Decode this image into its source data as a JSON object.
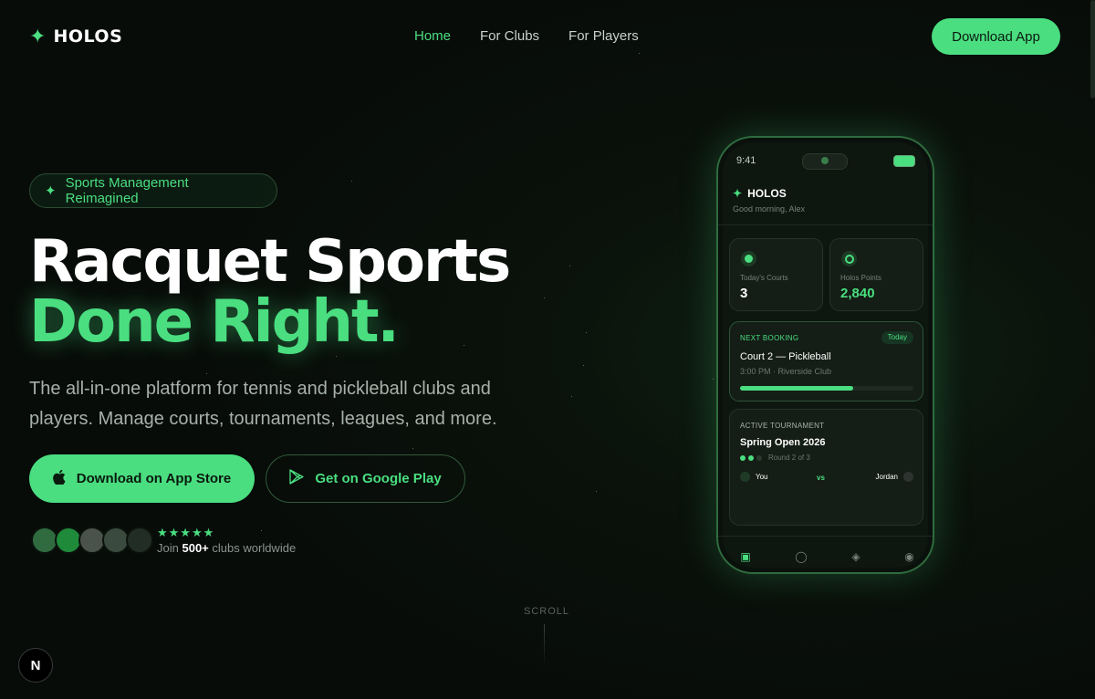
{
  "nav": {
    "brand": "HOLOS",
    "links": [
      "Home",
      "For Clubs",
      "For Players"
    ],
    "cta": "Download App"
  },
  "hero": {
    "badge": "Sports Management Reimagined",
    "title_line1": "Racquet Sports",
    "title_line2": "Done Right.",
    "subtitle": "The all-in-one platform for tennis and pickleball clubs and players. Manage courts, tournaments, leagues, and more.",
    "btn_app": "Download on App Store",
    "btn_play": "Get on Google Play",
    "stars": "★★★★★",
    "join_prefix": "Join",
    "join_count": "500+",
    "join_suffix": "clubs worldwide",
    "scroll": "SCROLL"
  },
  "phone": {
    "time": "9:41",
    "brand": "HOLOS",
    "greeting": "Good morning, Alex",
    "stat1_label": "Today's Courts",
    "stat1_value": "3",
    "stat2_label": "Holos Points",
    "stat2_value": "2,840",
    "booking_header": "NEXT BOOKING",
    "booking_tag": "Today",
    "booking_title": "Court 2 — Pickleball",
    "booking_sub": "3:00 PM · Riverside Club",
    "booking_progress": 0.65,
    "tour_header": "ACTIVE TOURNAMENT",
    "tour_title": "Spring Open 2026",
    "tour_round": "Round 2 of 3",
    "player_you": "You",
    "vs": "vs",
    "player_opp": "Jordan"
  },
  "misc": {
    "n_badge": "N"
  },
  "colors": {
    "accent": "#4ade80",
    "background": "#0a120b"
  },
  "icons": [
    "sparkle-icon",
    "apple-icon",
    "google-play-icon",
    "home-icon",
    "calendar-icon",
    "trophy-icon",
    "profile-icon"
  ]
}
